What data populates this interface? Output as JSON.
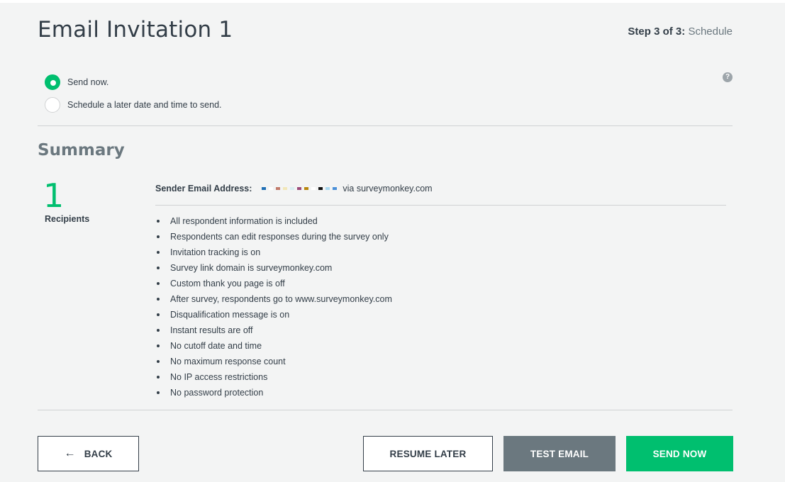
{
  "header": {
    "title": "Email Invitation 1",
    "step_prefix": "Step 3 of 3:",
    "step_name": "Schedule",
    "help_glyph": "?"
  },
  "schedule": {
    "options": [
      {
        "label": "Send now.",
        "checked": true
      },
      {
        "label": "Schedule a later date and time to send.",
        "checked": false
      }
    ]
  },
  "summary": {
    "title": "Summary",
    "recipient_count": "1",
    "recipient_label": "Recipients",
    "sender_label": "Sender Email Address:",
    "sender_suffix": "via surveymonkey.com",
    "redacted_colors": [
      "#1f6fb5",
      "#ffffff",
      "#c27b6b",
      "#f2e7b8",
      "#d8eef2",
      "#9c4b7a",
      "#b8860b",
      "#ffffff",
      "#111111",
      "#a9d8f0",
      "#4a90d9"
    ],
    "settings": [
      "All respondent information is included",
      "Respondents can edit responses during the survey only",
      "Invitation tracking is on",
      "Survey link domain is surveymonkey.com",
      "Custom thank you page is off",
      "After survey, respondents go to www.surveymonkey.com",
      "Disqualification message is on",
      "Instant results are off",
      "No cutoff date and time",
      "No maximum response count",
      "No IP access restrictions",
      "No password protection"
    ]
  },
  "footer": {
    "back_label": "BACK",
    "back_icon": "←",
    "resume_label": "RESUME LATER",
    "test_label": "TEST EMAIL",
    "send_label": "SEND NOW"
  },
  "colors": {
    "accent": "#00bf6f",
    "secondary": "#6b787f",
    "text": "#333e48"
  }
}
